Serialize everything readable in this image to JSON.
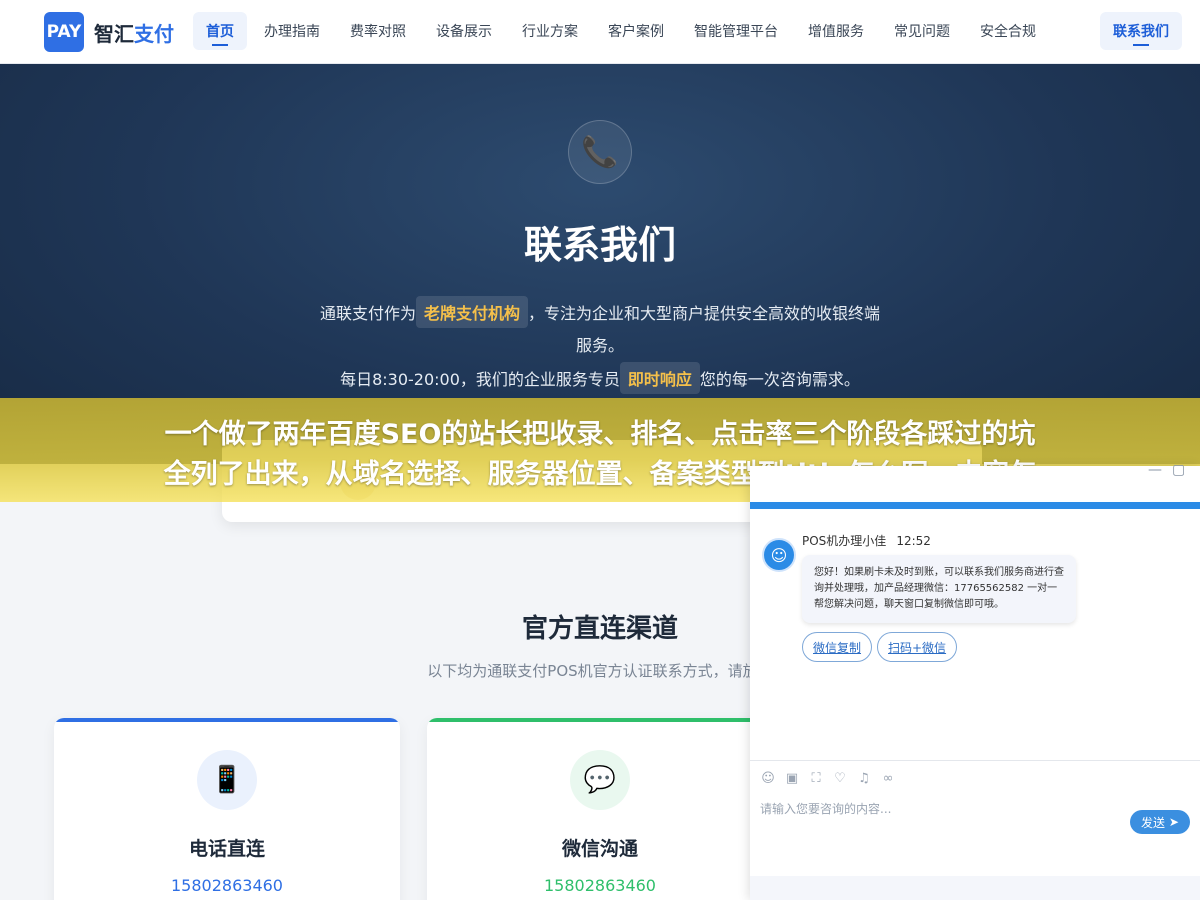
{
  "nav": {
    "logo_badge": "PAY",
    "logo_prefix": "智汇",
    "logo_suffix": "支付",
    "items": [
      "首页",
      "办理指南",
      "费率对照",
      "设备展示",
      "行业方案",
      "客户案例",
      "智能管理平台",
      "增值服务",
      "常见问题",
      "安全合规"
    ],
    "contact": "联系我们"
  },
  "hero": {
    "icon": "phone-icon",
    "title": "联系我们",
    "line1_pre": "通联支付作为",
    "line1_tag": "老牌支付机构",
    "line1_post": "，专注为企业和大型商户提供安全高效的收银终端",
    "line2": "服务。",
    "line3_pre": "每日8:30-20:00，我们的企业服务专员",
    "line3_tag": "即时响应",
    "line3_post": "您的每一次咨询需求。"
  },
  "banner": {
    "line1": "一个做了两年百度SEO的站长把收录、排名、点击率三个阶段各踩过的坑",
    "line2": "全列了出来，从域名选择、服务器位置、备案类型到title怎么写、内容怎"
  },
  "channels": {
    "title": "官方直连渠道",
    "subtitle": "以下均为通联支付POS机官方认证联系方式，请放心",
    "cards": [
      {
        "icon": "mobile-phone-icon",
        "title": "电话直连",
        "number": "15802863460",
        "color": "#2f6fe4"
      },
      {
        "icon": "wechat-chat-icon",
        "title": "微信沟通",
        "number": "15802863460",
        "color": "#2fbf6b"
      }
    ]
  },
  "chat": {
    "agent": "POS机办理小佳",
    "time": "12:52",
    "message": "您好！如果刷卡未及时到账，可以联系我们服务商进行查询并处理哦，加产品经理微信：17765562582 一对一帮您解决问题，聊天窗口复制微信即可哦。",
    "quick_buttons": [
      "微信复制",
      "扫码+微信"
    ],
    "input_placeholder": "请输入您要咨询的内容...",
    "send": "发送",
    "minimize": "—",
    "maximize": "▢"
  }
}
